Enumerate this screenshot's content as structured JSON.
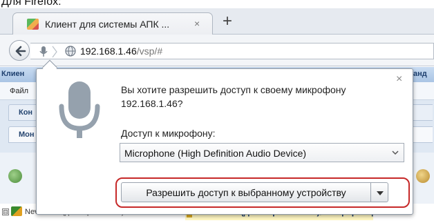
{
  "caption": "Для Firefox:",
  "browser": {
    "tab_title": "Клиент для системы АПК ...",
    "tab_close": "×",
    "new_tab": "+",
    "url_host": "192.168.1.46",
    "url_path": "/vsp/#",
    "icons": [
      "back-arrow-icon",
      "microphone-indicator-icon",
      "globe-icon",
      "site-favicon-icon"
    ]
  },
  "page": {
    "title_left": "Клиен",
    "title_right": "анд",
    "menu_left": "Файл",
    "tab1_left": "Кон",
    "tab2_left": "Мон",
    "tree_expander": "⊟",
    "tree_item_left": "Nevo-АЗС (для скриншотов) / #",
    "tree_item_right": "Nevo-АЗС (для скриншотов)/Конференц"
  },
  "permission_popup": {
    "question_line1": "Вы хотите разрешить доступ к своему микрофону",
    "question_line2": "192.168.1.46?",
    "close": "×",
    "device_label": "Доступ к микрофону:",
    "selected_device": "Microphone (High Definition Audio Device)",
    "allow_button": "Разрешить доступ к выбранному устройству",
    "highlight_color": "#c62828"
  }
}
